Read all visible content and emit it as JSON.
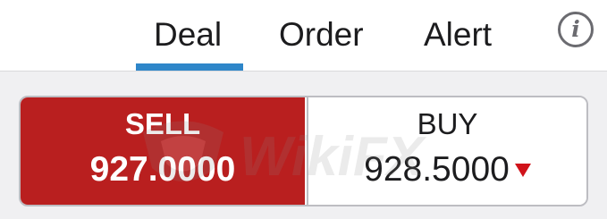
{
  "tabs": [
    {
      "label": "Deal",
      "selected": true
    },
    {
      "label": "Order",
      "selected": false
    },
    {
      "label": "Alert",
      "selected": false
    }
  ],
  "info": {
    "glyph": "i",
    "icon": "info-icon"
  },
  "deal": {
    "sell": {
      "label": "SELL",
      "price": "927.0000"
    },
    "buy": {
      "label": "BUY",
      "price": "928.5000",
      "trend_icon": "down-arrow-icon",
      "trend": "down"
    }
  },
  "watermark": {
    "text": "WikiFX"
  },
  "colors": {
    "sell_bg": "#b91f1f",
    "tab_underline": "#2e86c9",
    "down_arrow": "#d0121a"
  }
}
